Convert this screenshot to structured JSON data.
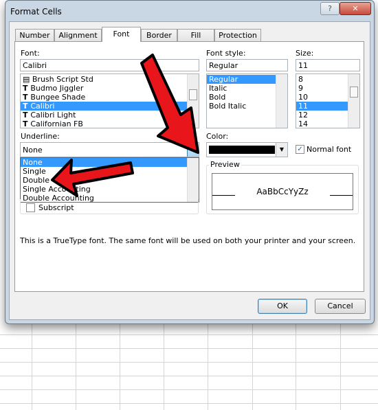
{
  "dialog": {
    "title": "Format Cells",
    "help_icon": "?",
    "close_icon": "✕"
  },
  "tabs": [
    {
      "label": "Number"
    },
    {
      "label": "Alignment"
    },
    {
      "label": "Font"
    },
    {
      "label": "Border"
    },
    {
      "label": "Fill"
    },
    {
      "label": "Protection"
    }
  ],
  "font": {
    "label": "Font:",
    "value": "Calibri",
    "items": [
      "Brush Script Std",
      "Budmo Jiggler",
      "Bungee Shade",
      "Calibri",
      "Calibri Light",
      "Californian FB"
    ],
    "selected": "Calibri"
  },
  "font_style": {
    "label": "Font style:",
    "value": "Regular",
    "items": [
      "Regular",
      "Italic",
      "Bold",
      "Bold Italic"
    ],
    "selected": "Regular"
  },
  "size": {
    "label": "Size:",
    "value": "11",
    "items": [
      "8",
      "9",
      "10",
      "11",
      "12",
      "14"
    ],
    "selected": "11"
  },
  "underline": {
    "label": "Underline:",
    "value": "None",
    "options": [
      "None",
      "Single",
      "Double",
      "Single Accounting",
      "Double Accounting"
    ],
    "highlighted": "None"
  },
  "color": {
    "label": "Color:",
    "value_hex": "#000000"
  },
  "normal_font": {
    "label": "Normal font",
    "checked": true
  },
  "effects": {
    "subscript_label": "Subscript",
    "subscript_checked": false
  },
  "preview": {
    "label": "Preview",
    "sample": "AaBbCcYyZz"
  },
  "info_text": "This is a TrueType font.  The same font will be used on both your printer and your screen.",
  "buttons": {
    "ok": "OK",
    "cancel": "Cancel"
  },
  "colors": {
    "selection": "#3399ff",
    "arrow": "#e8151b"
  }
}
